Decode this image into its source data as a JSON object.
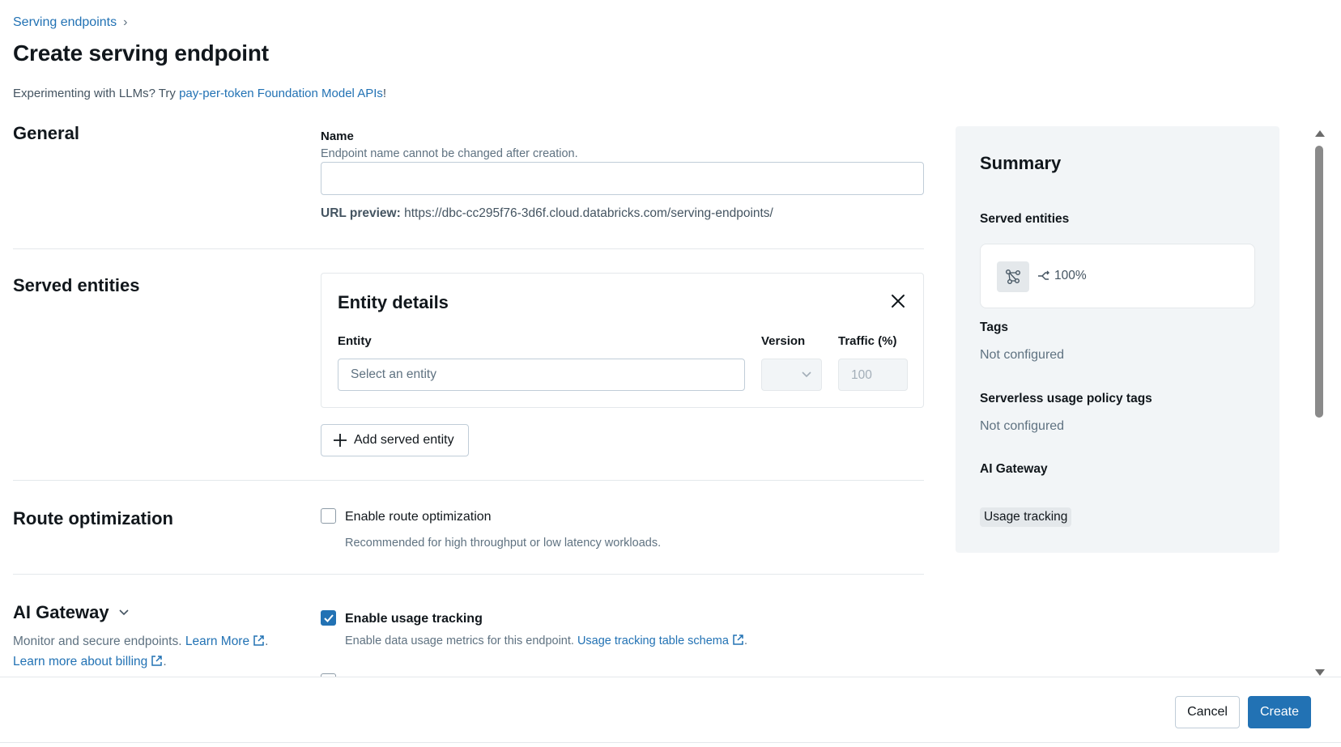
{
  "breadcrumb": {
    "parent": "Serving endpoints",
    "separator": "›"
  },
  "page_title": "Create serving endpoint",
  "llm_note": {
    "prefix": "Experimenting with LLMs? Try ",
    "link": "pay-per-token Foundation Model APIs",
    "suffix": "!"
  },
  "general": {
    "title": "General",
    "name_label": "Name",
    "name_help": "Endpoint name cannot be changed after creation.",
    "name_value": "",
    "url_preview_label": "URL preview:",
    "url_preview_value": "https://dbc-cc295f76-3d6f.cloud.databricks.com/serving-endpoints/"
  },
  "served_entities": {
    "title": "Served entities",
    "card_title": "Entity details",
    "entity_label": "Entity",
    "entity_placeholder": "Select an entity",
    "version_label": "Version",
    "traffic_label": "Traffic (%)",
    "traffic_value": "100",
    "add_button": "Add served entity"
  },
  "route_optimization": {
    "title": "Route optimization",
    "checkbox_label": "Enable route optimization",
    "checked": false,
    "help": "Recommended for high throughput or low latency workloads."
  },
  "ai_gateway": {
    "title": "AI Gateway",
    "desc_prefix": "Monitor and secure endpoints. ",
    "learn_more": "Learn More",
    "period": ".",
    "billing_link": "Learn more about billing",
    "usage_tracking_label": "Enable usage tracking",
    "usage_tracking_checked": true,
    "usage_help_prefix": "Enable data usage metrics for this endpoint. ",
    "usage_help_link": "Usage tracking table schema"
  },
  "summary": {
    "title": "Summary",
    "served_entities_label": "Served entities",
    "traffic_share": "100%",
    "tags_label": "Tags",
    "tags_value": "Not configured",
    "usage_policy_label": "Serverless usage policy tags",
    "usage_policy_value": "Not configured",
    "ai_gateway_label": "AI Gateway",
    "ai_gateway_tag": "Usage tracking"
  },
  "footer": {
    "cancel": "Cancel",
    "create": "Create"
  },
  "colors": {
    "accent": "#2272b4",
    "panel": "#f2f5f7",
    "border": "#c0cdd8"
  }
}
